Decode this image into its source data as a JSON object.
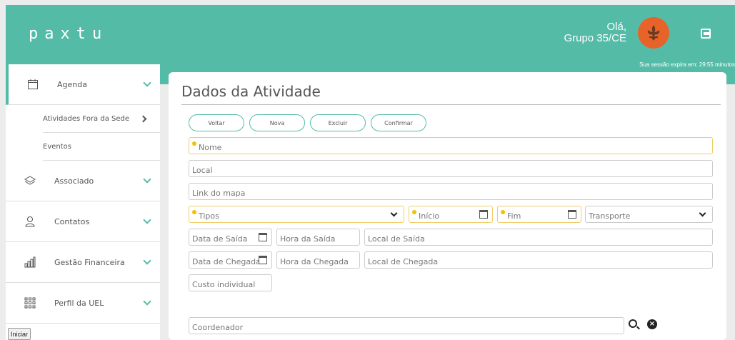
{
  "header": {
    "logo": "paxtu",
    "greeting_line1": "Olá,",
    "greeting_line2": "Grupo 35/CE",
    "session": "Sua sessão expira em: 29:55 minutos"
  },
  "sidebar": {
    "items": [
      {
        "label": "Agenda",
        "icon": "calendar-icon"
      },
      {
        "label": "Associado",
        "icon": "layers-icon"
      },
      {
        "label": "Contatos",
        "icon": "contact-icon"
      },
      {
        "label": "Gestão Financeira",
        "icon": "bar-chart-icon"
      },
      {
        "label": "Perfil da UEL",
        "icon": "grid-icon"
      }
    ],
    "subitems": [
      {
        "label": "Atividades Fora da Sede"
      },
      {
        "label": "Eventos"
      }
    ]
  },
  "taskbar": {
    "start_label": "Iniciar"
  },
  "form": {
    "title": "Dados da Atividade",
    "buttons": {
      "back": "Voltar",
      "new": "Nova",
      "delete": "Excluir",
      "confirm": "Confirmar"
    },
    "fields": {
      "nome": "Nome",
      "local": "Local",
      "link_mapa": "Link do mapa",
      "tipos": "Tipos",
      "inicio": "Início",
      "fim": "Fim",
      "transporte": "Transporte",
      "data_saida": "Data de Saída",
      "hora_saida": "Hora da Saída",
      "local_saida": "Local de Saída",
      "data_chegada": "Data de Chegada",
      "hora_chegada": "Hora da Chegada",
      "local_chegada": "Local de Chegada",
      "custo": "Custo individual",
      "coordenador": "Coordenador"
    }
  }
}
